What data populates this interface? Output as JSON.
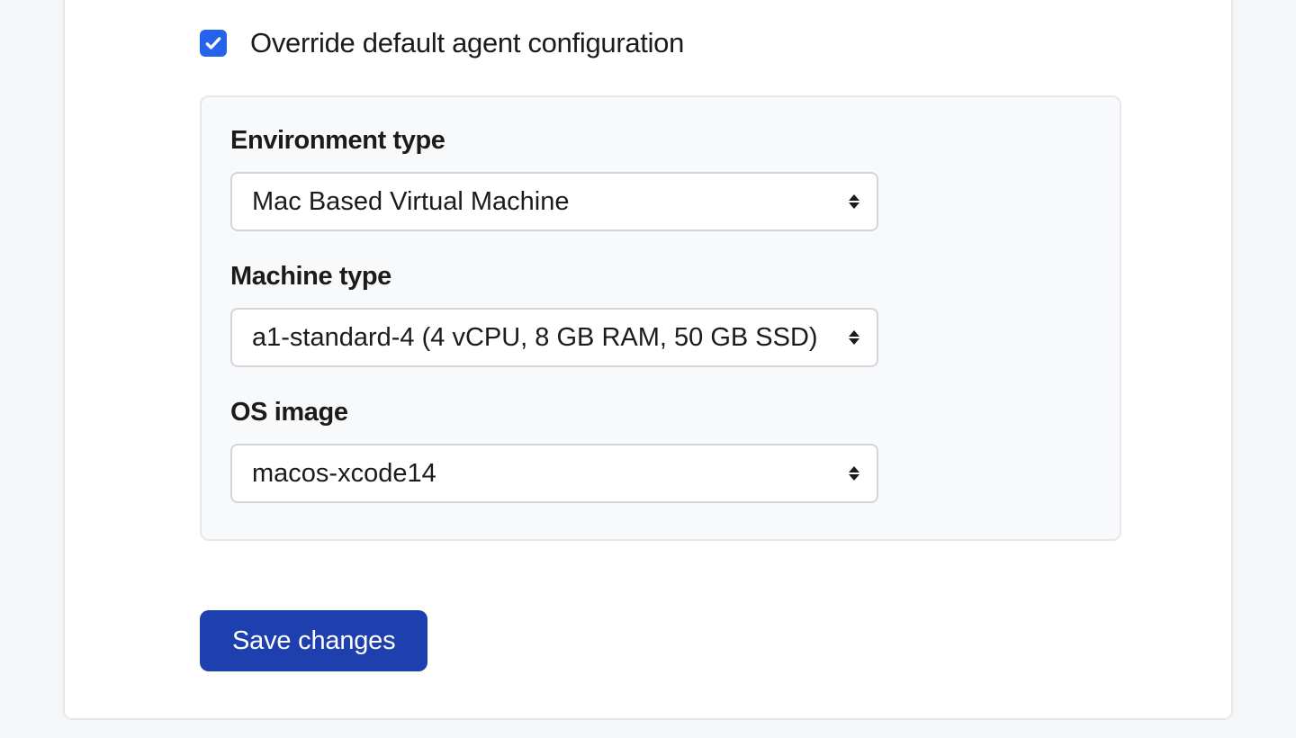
{
  "override": {
    "checked": true,
    "label": "Override default agent configuration"
  },
  "fields": {
    "environment": {
      "label": "Environment type",
      "value": "Mac Based Virtual Machine"
    },
    "machine": {
      "label": "Machine type",
      "value": "a1-standard-4 (4 vCPU, 8 GB RAM, 50 GB SSD)"
    },
    "os": {
      "label": "OS image",
      "value": "macos-xcode14"
    }
  },
  "actions": {
    "save": "Save changes"
  },
  "colors": {
    "checkbox": "#2563eb",
    "save_button": "#1e40af"
  }
}
